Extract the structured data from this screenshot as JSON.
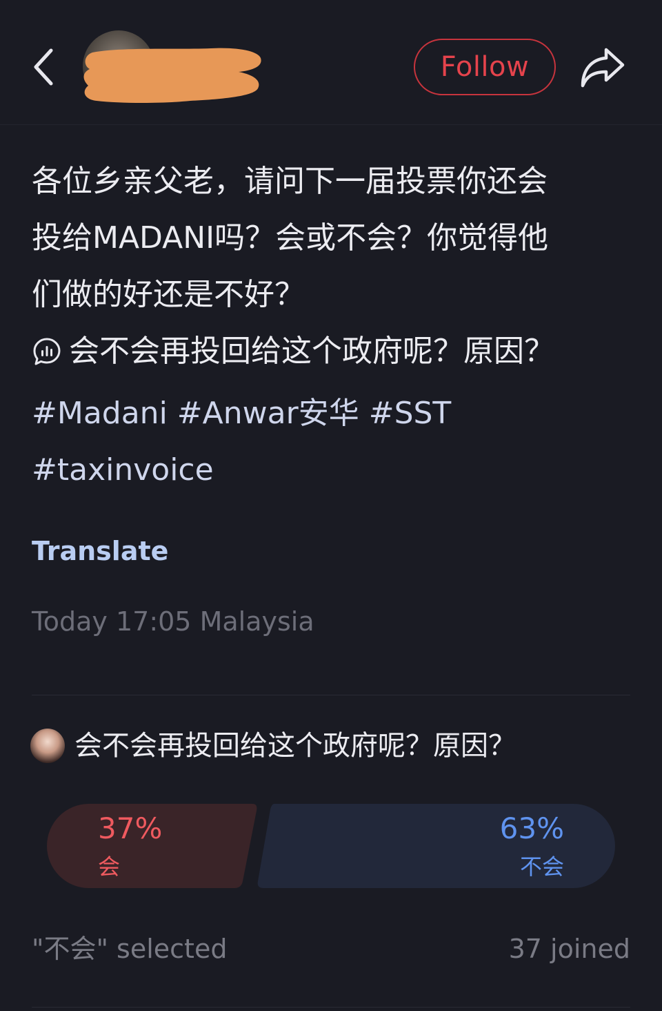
{
  "header": {
    "follow_label": "Follow",
    "back_icon": "chevron-left-icon",
    "share_icon": "share-arrow-icon"
  },
  "post": {
    "lines": [
      "各位乡亲父老，请问下一届投票你还会",
      "投给MADANI吗？会或不会？你觉得他",
      "们做的好还是不好？"
    ],
    "poll_line": "会不会再投回给这个政府呢？原因？",
    "hashtags_line1": [
      "#Madani",
      "#Anwar安华",
      "#SST"
    ],
    "hashtags_line2": [
      "#taxinvoice"
    ],
    "translate_label": "Translate",
    "timestamp": "Today 17:05 Malaysia"
  },
  "poll": {
    "question": "会不会再投回给这个政府呢？原因？",
    "options": [
      {
        "percent": "37%",
        "label": "会",
        "value": 0.37,
        "color": "#ef5a5f"
      },
      {
        "percent": "63%",
        "label": "不会",
        "value": 0.63,
        "color": "#5f93ef"
      }
    ],
    "selected_text": "\"不会\" selected",
    "joined_text": "37 joined"
  },
  "colors": {
    "background": "#1a1b23",
    "accent_red": "#e5434c",
    "link_blue": "#b9cdf2",
    "muted": "#7a7b85"
  }
}
